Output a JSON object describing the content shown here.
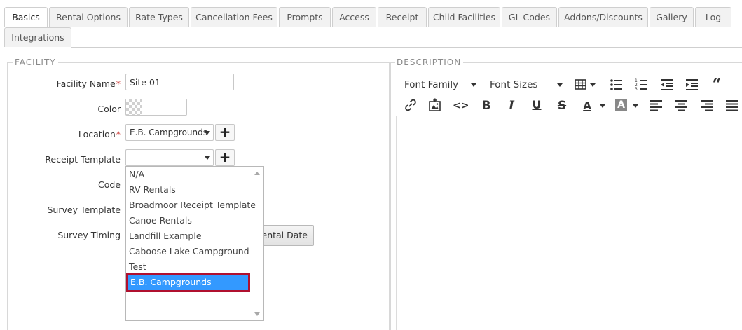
{
  "tabs": [
    {
      "label": "Basics",
      "active": true
    },
    {
      "label": "Rental Options"
    },
    {
      "label": "Rate Types"
    },
    {
      "label": "Cancellation Fees"
    },
    {
      "label": "Prompts"
    },
    {
      "label": "Access"
    },
    {
      "label": "Receipt"
    },
    {
      "label": "Child Facilities"
    },
    {
      "label": "GL Codes"
    },
    {
      "label": "Addons/Discounts"
    },
    {
      "label": "Gallery"
    },
    {
      "label": "Log"
    },
    {
      "label": "Integrations"
    }
  ],
  "facility": {
    "legend": "FACILITY",
    "facility_name_label": "Facility Name",
    "facility_name_value": "Site 01",
    "required_mark": "*",
    "color_label": "Color",
    "location_label": "Location",
    "location_value": "E.B. Campgrounds",
    "receipt_template_label": "Receipt Template",
    "receipt_template_value": "",
    "code_label": "Code",
    "survey_template_label": "Survey Template",
    "survey_timing_label": "Survey Timing",
    "survey_timing_button": "Rental Date",
    "dropdown_options": [
      "N/A",
      "RV Rentals",
      "Broadmoor Receipt Template",
      "Canoe Rentals",
      "Landfill Example",
      "Caboose Lake Campground",
      "Test",
      "E.B. Campgrounds"
    ],
    "dropdown_selected_index": 7
  },
  "description": {
    "legend": "DESCRIPTION",
    "font_family_label": "Font Family",
    "font_sizes_label": "Font Sizes"
  },
  "colors": {
    "selected_option": "#3399ff",
    "highlight_outline": "#b0102f",
    "required": "#c9302c"
  }
}
